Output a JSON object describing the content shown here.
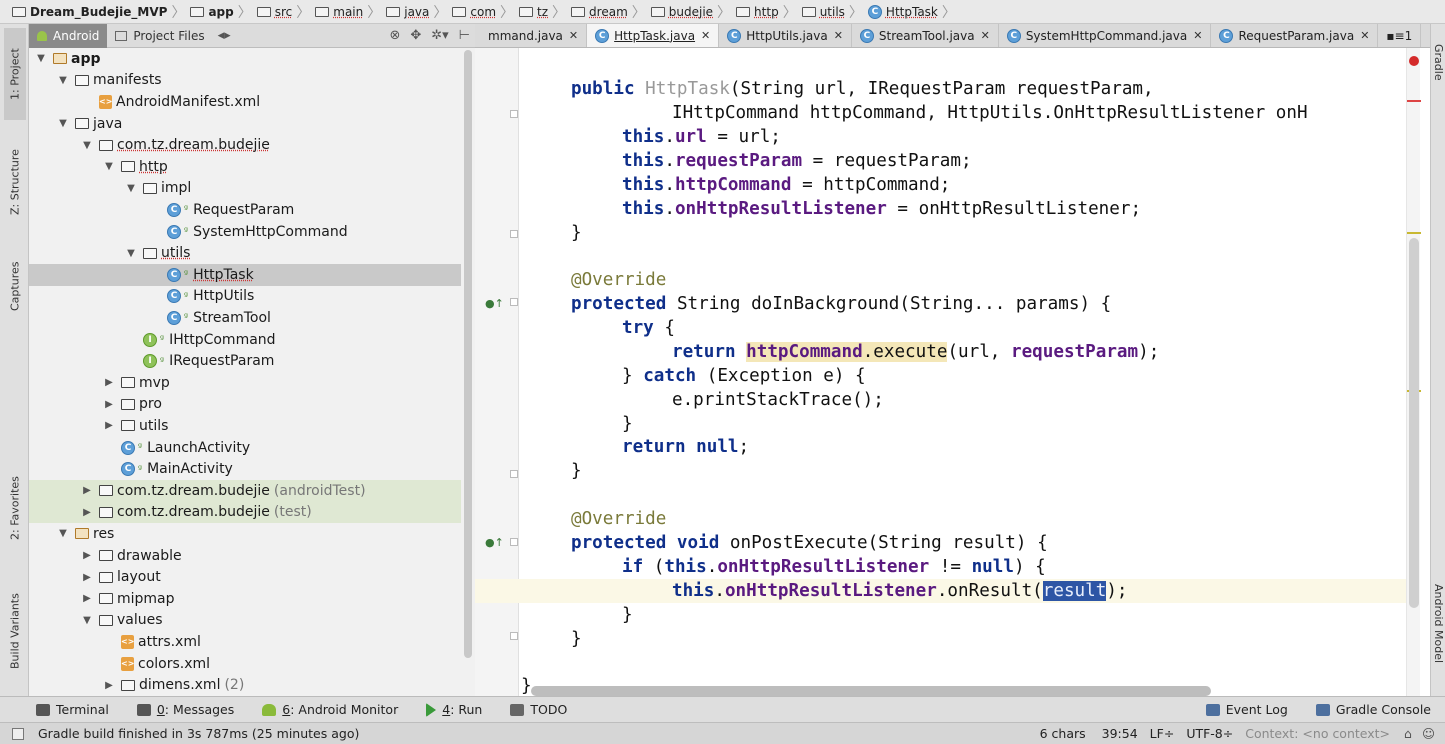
{
  "breadcrumb": [
    {
      "label": "Dream_Budejie_MVP",
      "bold": true,
      "icon": "project-icon"
    },
    {
      "label": "app",
      "bold": true,
      "icon": "module-icon"
    },
    {
      "label": "src",
      "icon": "folder-icon"
    },
    {
      "label": "main",
      "icon": "folder-icon"
    },
    {
      "label": "java",
      "icon": "folder-icon"
    },
    {
      "label": "com",
      "icon": "folder-icon"
    },
    {
      "label": "tz",
      "icon": "folder-icon"
    },
    {
      "label": "dream",
      "icon": "folder-icon"
    },
    {
      "label": "budejie",
      "icon": "folder-icon"
    },
    {
      "label": "http",
      "icon": "folder-icon"
    },
    {
      "label": "utils",
      "icon": "folder-icon"
    },
    {
      "label": "HttpTask",
      "icon": "class-icon"
    }
  ],
  "left_strip": {
    "project": "1: Project",
    "structure": "Z: Structure",
    "captures": "Captures",
    "favorites": "2: Favorites",
    "build_variants": "Build Variants"
  },
  "right_strip": {
    "gradle": "Gradle",
    "android_model": "Android Model"
  },
  "project_panel": {
    "view_tab": "Android",
    "files_tab": "Project Files"
  },
  "tree": [
    {
      "level": 0,
      "arrow": "▼",
      "icon": "module",
      "label": "app",
      "bold": true
    },
    {
      "level": 1,
      "arrow": "▼",
      "icon": "folder",
      "label": "manifests"
    },
    {
      "level": 2,
      "arrow": "",
      "icon": "xml",
      "label": "AndroidManifest.xml"
    },
    {
      "level": 1,
      "arrow": "▼",
      "icon": "folder",
      "label": "java"
    },
    {
      "level": 2,
      "arrow": "▼",
      "icon": "folder",
      "label": "com.tz.dream.budejie",
      "underline": true
    },
    {
      "level": 3,
      "arrow": "▼",
      "icon": "folder",
      "label": "http",
      "underline": true
    },
    {
      "level": 4,
      "arrow": "▼",
      "icon": "folder",
      "label": "impl"
    },
    {
      "level": 5,
      "arrow": "",
      "icon": "class",
      "label": "RequestParam"
    },
    {
      "level": 5,
      "arrow": "",
      "icon": "class",
      "label": "SystemHttpCommand"
    },
    {
      "level": 4,
      "arrow": "▼",
      "icon": "folder",
      "label": "utils",
      "underline": true
    },
    {
      "level": 5,
      "arrow": "",
      "icon": "class",
      "label": "HttpTask",
      "selected": true,
      "underline": true
    },
    {
      "level": 5,
      "arrow": "",
      "icon": "class",
      "label": "HttpUtils"
    },
    {
      "level": 5,
      "arrow": "",
      "icon": "class",
      "label": "StreamTool"
    },
    {
      "level": 4,
      "arrow": "",
      "icon": "interface",
      "label": "IHttpCommand"
    },
    {
      "level": 4,
      "arrow": "",
      "icon": "interface",
      "label": "IRequestParam"
    },
    {
      "level": 3,
      "arrow": "▶",
      "icon": "folder",
      "label": "mvp"
    },
    {
      "level": 3,
      "arrow": "▶",
      "icon": "folder",
      "label": "pro"
    },
    {
      "level": 3,
      "arrow": "▶",
      "icon": "folder",
      "label": "utils"
    },
    {
      "level": 3,
      "arrow": "",
      "icon": "class",
      "label": "LaunchActivity"
    },
    {
      "level": 3,
      "arrow": "",
      "icon": "class",
      "label": "MainActivity"
    },
    {
      "level": 2,
      "arrow": "▶",
      "icon": "folder",
      "label": "com.tz.dream.budejie",
      "suffix": "(androidTest)",
      "green": true
    },
    {
      "level": 2,
      "arrow": "▶",
      "icon": "folder",
      "label": "com.tz.dream.budejie",
      "suffix": "(test)",
      "green": true
    },
    {
      "level": 1,
      "arrow": "▼",
      "icon": "res",
      "label": "res"
    },
    {
      "level": 2,
      "arrow": "▶",
      "icon": "folder",
      "label": "drawable"
    },
    {
      "level": 2,
      "arrow": "▶",
      "icon": "folder",
      "label": "layout"
    },
    {
      "level": 2,
      "arrow": "▶",
      "icon": "folder",
      "label": "mipmap"
    },
    {
      "level": 2,
      "arrow": "▼",
      "icon": "folder",
      "label": "values"
    },
    {
      "level": 3,
      "arrow": "",
      "icon": "xml",
      "label": "attrs.xml"
    },
    {
      "level": 3,
      "arrow": "",
      "icon": "xml",
      "label": "colors.xml"
    },
    {
      "level": 3,
      "arrow": "▶",
      "icon": "folder",
      "label": "dimens.xml",
      "suffix": "(2)"
    }
  ],
  "editor_tabs": [
    {
      "label": "mmand.java",
      "icon": false
    },
    {
      "label": "HttpTask.java",
      "icon": true,
      "active": true
    },
    {
      "label": "HttpUtils.java",
      "icon": true
    },
    {
      "label": "StreamTool.java",
      "icon": true
    },
    {
      "label": "SystemHttpCommand.java",
      "icon": true
    },
    {
      "label": "RequestParam.java",
      "icon": true
    }
  ],
  "tabs_overflow": "▪≡1",
  "code": {
    "l1": [
      "public ",
      "HttpTask",
      "(String url, IRequestParam requestParam,"
    ],
    "l2": "IHttpCommand httpCommand, HttpUtils.OnHttpResultListener onH",
    "l3": [
      "this",
      ".",
      "url",
      " = url;"
    ],
    "l4": [
      "this",
      ".",
      "requestParam",
      " = requestParam;"
    ],
    "l5": [
      "this",
      ".",
      "httpCommand",
      " = httpCommand;"
    ],
    "l6": [
      "this",
      ".",
      "onHttpResultListener",
      " = onHttpResultListener;"
    ],
    "l7": "}",
    "l8": "@Override",
    "l9": [
      "protected ",
      "String doInBackground(String... params) {"
    ],
    "l10": [
      "try",
      " {"
    ],
    "l11": [
      "return ",
      "httpCommand",
      ".execute",
      "(url, ",
      "requestParam",
      ");"
    ],
    "l12": [
      "} ",
      "catch",
      " (Exception e) {"
    ],
    "l13": "e.printStackTrace();",
    "l14": "}",
    "l15": [
      "return null",
      ";"
    ],
    "l16": "}",
    "l17": "@Override",
    "l18": [
      "protected void ",
      "onPostExecute(String result) {"
    ],
    "l19": [
      "if",
      " (",
      "this",
      ".",
      "onHttpResultListener",
      " != ",
      "null",
      ") {"
    ],
    "l20": [
      "this",
      ".",
      "onHttpResultListener",
      ".onResult(",
      "result",
      ");"
    ],
    "l21": "}",
    "l22": "}",
    "l23": "}"
  },
  "tool_windows": {
    "terminal": "Terminal",
    "messages_num": "0",
    "messages": ": Messages",
    "monitor_num": "6",
    "monitor": ": Android Monitor",
    "run_num": "4",
    "run": ": Run",
    "todo": "TODO",
    "event_log": "Event Log",
    "gradle_console": "Gradle Console"
  },
  "status": {
    "message": "Gradle build finished in 3s 787ms (25 minutes ago)",
    "chars": "6 chars",
    "position": "39:54",
    "line_sep": "LF÷",
    "encoding": "UTF-8÷",
    "context_label": "Context:",
    "context_value": "<no context>"
  }
}
